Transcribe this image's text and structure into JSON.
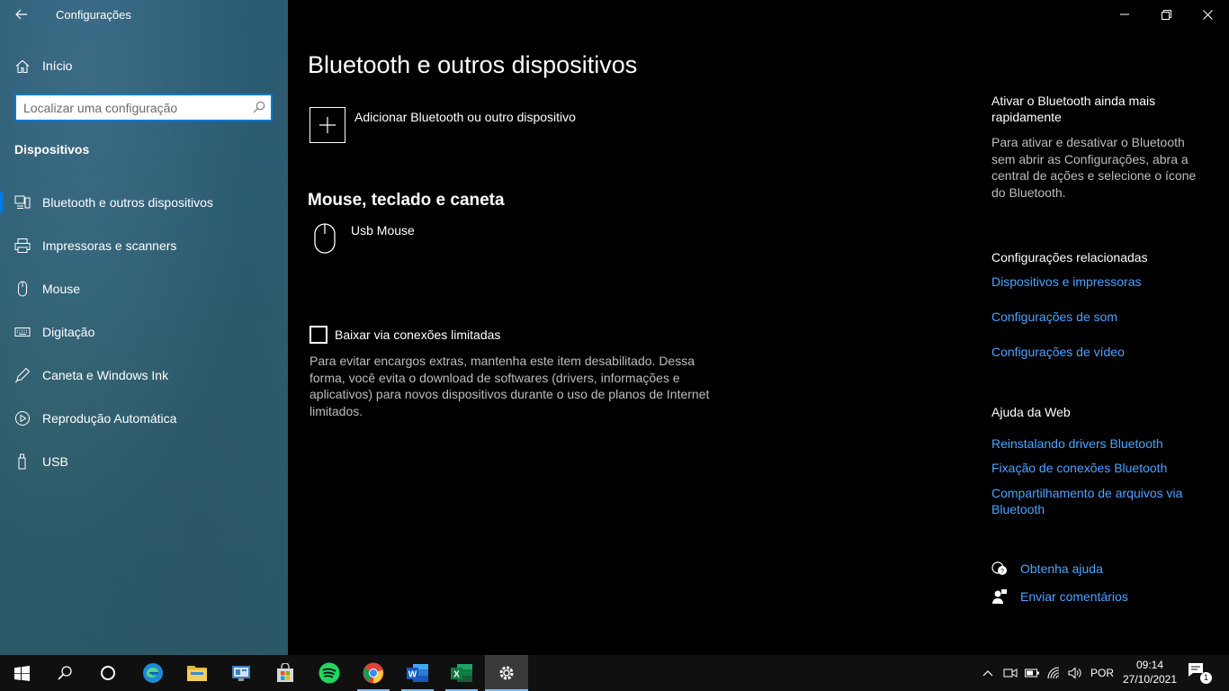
{
  "window": {
    "title": "Configurações"
  },
  "sidebar": {
    "home_label": "Início",
    "search_placeholder": "Localizar uma configuração",
    "section_heading": "Dispositivos",
    "items": [
      {
        "label": "Bluetooth e outros dispositivos",
        "icon": "bluetooth-devices-icon",
        "active": true
      },
      {
        "label": "Impressoras e scanners",
        "icon": "printer-icon",
        "active": false
      },
      {
        "label": "Mouse",
        "icon": "mouse-icon",
        "active": false
      },
      {
        "label": "Digitação",
        "icon": "keyboard-icon",
        "active": false
      },
      {
        "label": "Caneta e Windows Ink",
        "icon": "pen-icon",
        "active": false
      },
      {
        "label": "Reprodução Automática",
        "icon": "autoplay-icon",
        "active": false
      },
      {
        "label": "USB",
        "icon": "usb-icon",
        "active": false
      }
    ]
  },
  "main": {
    "title": "Bluetooth e outros dispositivos",
    "add_device_label": "Adicionar Bluetooth ou outro dispositivo",
    "mouse_section_title": "Mouse, teclado e caneta",
    "devices": [
      {
        "name": "Usb Mouse",
        "icon": "mouse-icon"
      }
    ],
    "metered_checkbox_label": "Baixar via conexões limitadas",
    "metered_checked": false,
    "metered_description": "Para evitar encargos extras, mantenha este item desabilitado. Dessa forma, você evita o download de softwares (drivers, informações e aplicativos) para novos dispositivos durante o uso de planos de Internet limitados."
  },
  "right_panel": {
    "quick_heading": "Ativar o Bluetooth ainda mais rapidamente",
    "quick_text": "Para ativar e desativar o Bluetooth sem abrir as Configurações, abra a central de ações e selecione o ícone do Bluetooth.",
    "related_heading": "Configurações relacionadas",
    "related_links": [
      "Dispositivos e impressoras",
      "Configurações de som",
      "Configurações de vídeo"
    ],
    "web_help_heading": "Ajuda da Web",
    "web_help_links": [
      "Reinstalando drivers Bluetooth",
      "Fixação de conexões Bluetooth",
      "Compartilhamento de arquivos via Bluetooth"
    ],
    "get_help_label": "Obtenha ajuda",
    "feedback_label": "Enviar comentários"
  },
  "taskbar": {
    "language": "POR",
    "time": "09:14",
    "date": "27/10/2021",
    "notification_count": "1",
    "colors": {
      "accent": "#0078d7",
      "link": "#4da3ff"
    }
  }
}
